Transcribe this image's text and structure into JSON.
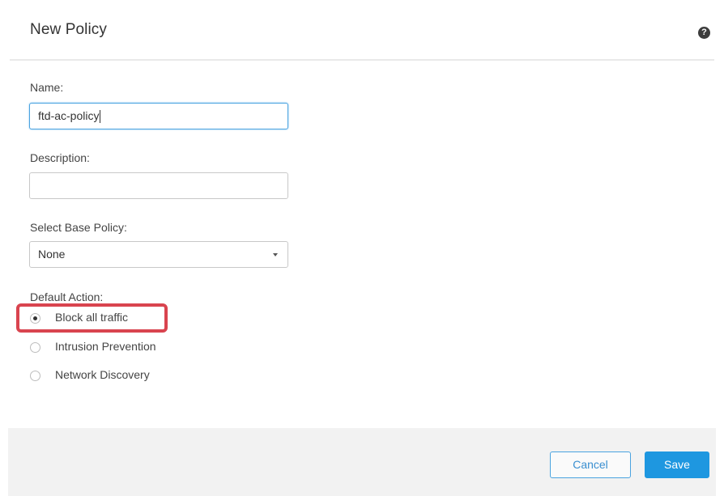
{
  "dialog": {
    "title": "New Policy",
    "help_icon_glyph": "?",
    "help_icon": "question-circle-icon"
  },
  "form": {
    "name": {
      "label": "Name:",
      "value": "ftd-ac-policy"
    },
    "description": {
      "label": "Description:",
      "value": ""
    },
    "base_policy": {
      "label": "Select Base Policy:",
      "selected": "None"
    },
    "default_action": {
      "label": "Default Action:",
      "options": [
        {
          "label": "Block all traffic",
          "checked": true
        },
        {
          "label": "Intrusion Prevention",
          "checked": false
        },
        {
          "label": "Network Discovery",
          "checked": false
        }
      ]
    }
  },
  "footer": {
    "cancel_label": "Cancel",
    "save_label": "Save"
  },
  "colors": {
    "highlight": "#d9444f",
    "primary": "#1e97e0",
    "focus_border": "#4aa3e0"
  }
}
